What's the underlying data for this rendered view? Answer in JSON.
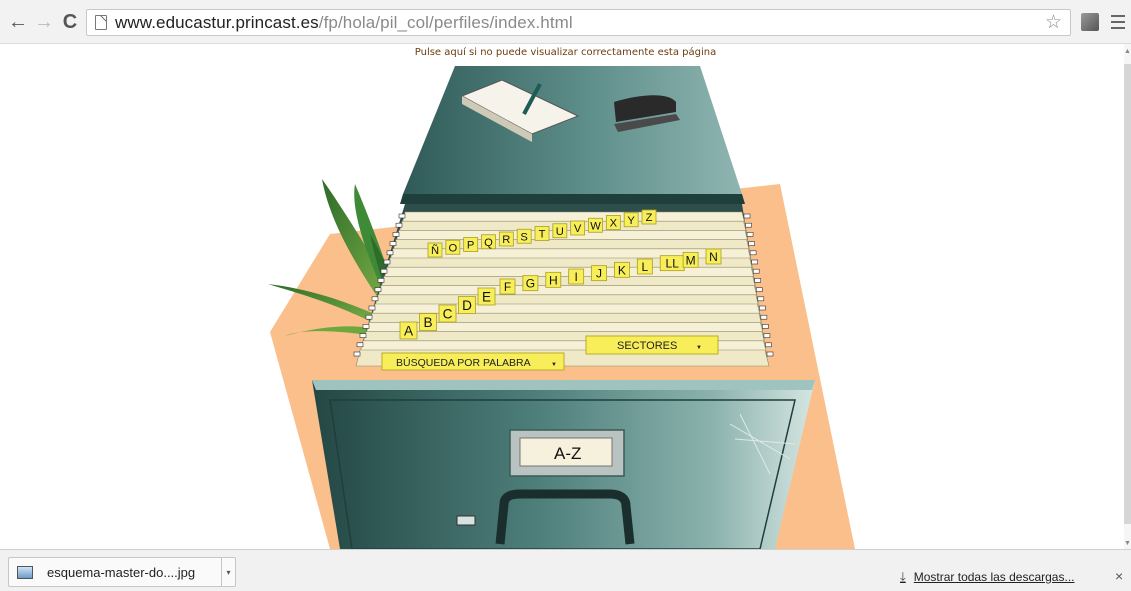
{
  "browser": {
    "back_icon": "arrow-left",
    "forward_icon": "arrow-right",
    "reload_icon": "reload",
    "url_host": "www.educastur.princast.es",
    "url_path": "/fp/hola/pil_col/perfiles/index.html",
    "back_glyph": "←",
    "forward_glyph": "→",
    "reload_glyph": "C",
    "star_glyph": "☆"
  },
  "page": {
    "notice": "Pulse aquí si no puede visualizar correctamente esta página",
    "cabinet": {
      "drawer_label": "A-Z",
      "letters_row1": [
        "Ñ",
        "O",
        "P",
        "Q",
        "R",
        "S",
        "T",
        "U",
        "V",
        "W",
        "X",
        "Y",
        "Z"
      ],
      "letters_row2": [
        "F",
        "G",
        "H",
        "I",
        "J",
        "K",
        "L",
        "LL",
        "M",
        "N"
      ],
      "letters_row3": [
        "A",
        "B",
        "C",
        "D",
        "E"
      ],
      "search_tab": "BÚSQUEDA POR PALABRA",
      "sectors_tab": "SECTORES",
      "dropdown_glyph": "▼"
    },
    "colors": {
      "cabinet": "#3f6f6a",
      "folder": "#f3eed0",
      "tab": "#f7ee5a",
      "backdrop": "#fbbf8b"
    }
  },
  "downloads": {
    "file_name": "esquema-master-do....jpg",
    "show_all": "Mostrar todas las descargas...",
    "close_glyph": "×",
    "caret_glyph": "▾",
    "download_glyph": "⤓"
  }
}
